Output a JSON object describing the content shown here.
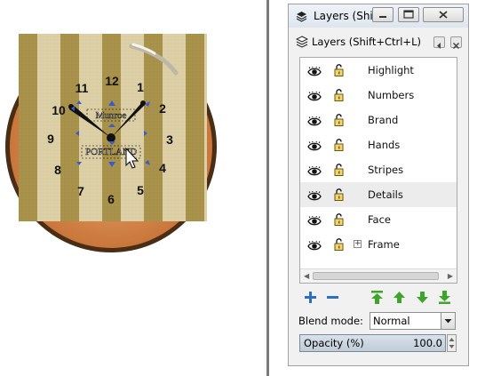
{
  "window": {
    "title": "Layers (Shi…",
    "dock_title": "Layers (Shift+Ctrl+L)"
  },
  "layers": [
    {
      "name": "Highlight",
      "visible": true,
      "locked": false,
      "selected": false,
      "has_children": false
    },
    {
      "name": "Numbers",
      "visible": true,
      "locked": false,
      "selected": false,
      "has_children": false
    },
    {
      "name": "Brand",
      "visible": true,
      "locked": false,
      "selected": false,
      "has_children": false
    },
    {
      "name": "Hands",
      "visible": true,
      "locked": false,
      "selected": false,
      "has_children": false
    },
    {
      "name": "Stripes",
      "visible": true,
      "locked": false,
      "selected": false,
      "has_children": false
    },
    {
      "name": "Details",
      "visible": true,
      "locked": false,
      "selected": true,
      "has_children": false
    },
    {
      "name": "Face",
      "visible": true,
      "locked": false,
      "selected": false,
      "has_children": false
    },
    {
      "name": "Frame",
      "visible": true,
      "locked": false,
      "selected": false,
      "has_children": true
    }
  ],
  "blend_mode": {
    "label": "Blend mode:",
    "value": "Normal"
  },
  "opacity": {
    "label": "Opacity (%)",
    "value": "100.0"
  },
  "canvas": {
    "clock_numbers": [
      "12",
      "1",
      "2",
      "3",
      "4",
      "5",
      "6",
      "7",
      "8",
      "9",
      "10",
      "11"
    ],
    "brand_text_top": "Munroe",
    "brand_text_bottom": "PORTLAND",
    "colors": {
      "stripe_gold": "#a8924a",
      "stripe_light": "#dccfa5",
      "rim": "#5a3a1c",
      "face_orange": "#d98c4a",
      "handle_blue": "#3a5bd0"
    }
  },
  "colors": {
    "add_icon": "#2f6ec0",
    "move_icon": "#3fa32c",
    "selected_row": "#ececec"
  }
}
